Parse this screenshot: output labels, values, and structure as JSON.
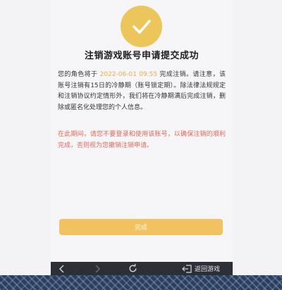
{
  "page": {
    "title": "注销游戏账号申请提交成功",
    "notice": {
      "prefix": "您的角色将于 ",
      "date": "2022-06-01 09:55",
      "suffix": " 完成注销。请注意，该账号注销有15日的冷静期（账号锁定期）。除法律法规规定和注销协议约定情形外，我们将在冷静期满后完成注销，删除或匿名化处理您的个人信息。"
    },
    "warning": "在此期间，请您不要登录和使用该账号，以确保注销的顺利完成，否则视为您撤销注销申请。",
    "done_button": "完成"
  },
  "navbar": {
    "exit_label": "返回游戏"
  },
  "colors": {
    "accent": "#ecc65a",
    "button": "#f3c260",
    "date_highlight": "#e2b04c",
    "warning_text": "#e0665a",
    "navbar": "#2c2f36"
  },
  "icons": {
    "badge": "checkmark-icon",
    "nav": [
      "back-arrow-icon",
      "forward-arrow-icon",
      "refresh-icon",
      "exit-icon"
    ]
  }
}
